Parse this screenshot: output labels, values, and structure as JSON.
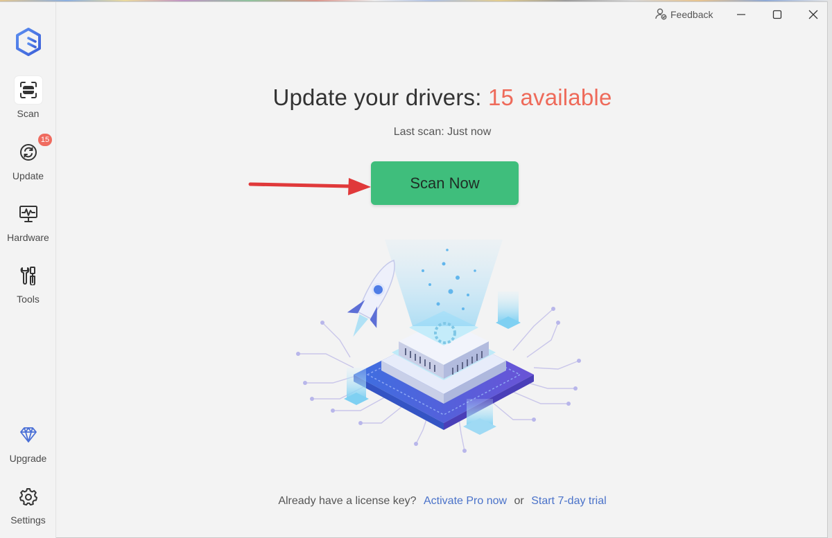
{
  "window": {
    "feedback_label": "Feedback"
  },
  "sidebar": {
    "items": [
      {
        "label": "Scan",
        "icon": "scan-icon",
        "active": true
      },
      {
        "label": "Update",
        "icon": "update-icon",
        "badge": "15"
      },
      {
        "label": "Hardware",
        "icon": "hardware-icon"
      },
      {
        "label": "Tools",
        "icon": "tools-icon"
      },
      {
        "label": "Upgrade",
        "icon": "diamond-icon"
      },
      {
        "label": "Settings",
        "icon": "gear-icon"
      }
    ]
  },
  "main": {
    "headline_prefix": "Update your drivers: ",
    "headline_count": "15 available",
    "last_scan": "Last scan: Just now",
    "scan_button": "Scan Now",
    "footer": {
      "prompt": "Already have a license key?",
      "activate_link": "Activate Pro now",
      "or": "or",
      "trial_link": "Start 7-day trial"
    }
  },
  "colors": {
    "accent_green": "#3fbe7c",
    "highlight_red": "#ee6a5a",
    "link_blue": "#4a72c9",
    "badge_red": "#ef6b5f",
    "arrow_red": "#e0393a"
  }
}
